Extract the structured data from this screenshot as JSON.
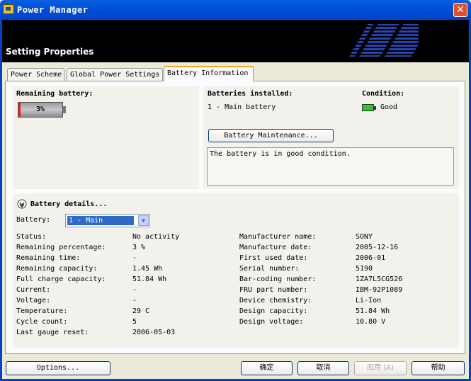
{
  "window": {
    "title": "Power Manager",
    "close_glyph": "✕",
    "app_icon": "power-manager-icon"
  },
  "banner": {
    "title": "Setting Properties",
    "logo": "IBM"
  },
  "tabs": [
    {
      "label": "Power Scheme"
    },
    {
      "label": "Global Power Settings"
    },
    {
      "label": "Battery Information"
    }
  ],
  "remaining": {
    "label": "Remaining battery:",
    "percent_text": "3%",
    "percent_value": 3
  },
  "installed": {
    "label": "Batteries installed:",
    "value": "1 - Main battery"
  },
  "condition": {
    "label": "Condition:",
    "value": "Good"
  },
  "maintenance_button": "Battery Maintenance...",
  "message": "The battery is in good condition.",
  "details": {
    "header": "Battery details...",
    "battery_label": "Battery:",
    "battery_selected": "1 - Main",
    "left": [
      {
        "label": "Status:",
        "value": "No activity"
      },
      {
        "label": "Remaining percentage:",
        "value": "3 %"
      },
      {
        "label": "Remaining time:",
        "value": "-"
      },
      {
        "label": "Remaining capacity:",
        "value": "1.45 Wh"
      },
      {
        "label": "Full charge capacity:",
        "value": "51.84 Wh"
      },
      {
        "label": "Current:",
        "value": "-"
      },
      {
        "label": "Voltage:",
        "value": "-"
      },
      {
        "label": "Temperature:",
        "value": "29 C"
      },
      {
        "label": "Cycle count:",
        "value": "5"
      },
      {
        "label": "Last gauge reset:",
        "value": "2006-05-03"
      }
    ],
    "right": [
      {
        "label": "Manufacturer name:",
        "value": "SONY"
      },
      {
        "label": "Manufacture date:",
        "value": "2005-12-16"
      },
      {
        "label": "First used date:",
        "value": "2006-01"
      },
      {
        "label": "Serial number:",
        "value": "5190"
      },
      {
        "label": "Bar-coding number:",
        "value": "1ZA7L5CG526"
      },
      {
        "label": "FRU part number:",
        "value": "IBM-92P1089"
      },
      {
        "label": "Device chemistry:",
        "value": "Li-Ion"
      },
      {
        "label": "Design capacity:",
        "value": "51.84 Wh"
      },
      {
        "label": "Design voltage:",
        "value": "10.80 V"
      }
    ]
  },
  "footer": {
    "options": "Options...",
    "ok": "确定",
    "cancel": "取消",
    "apply": "应用 (A)",
    "help": "帮助"
  }
}
